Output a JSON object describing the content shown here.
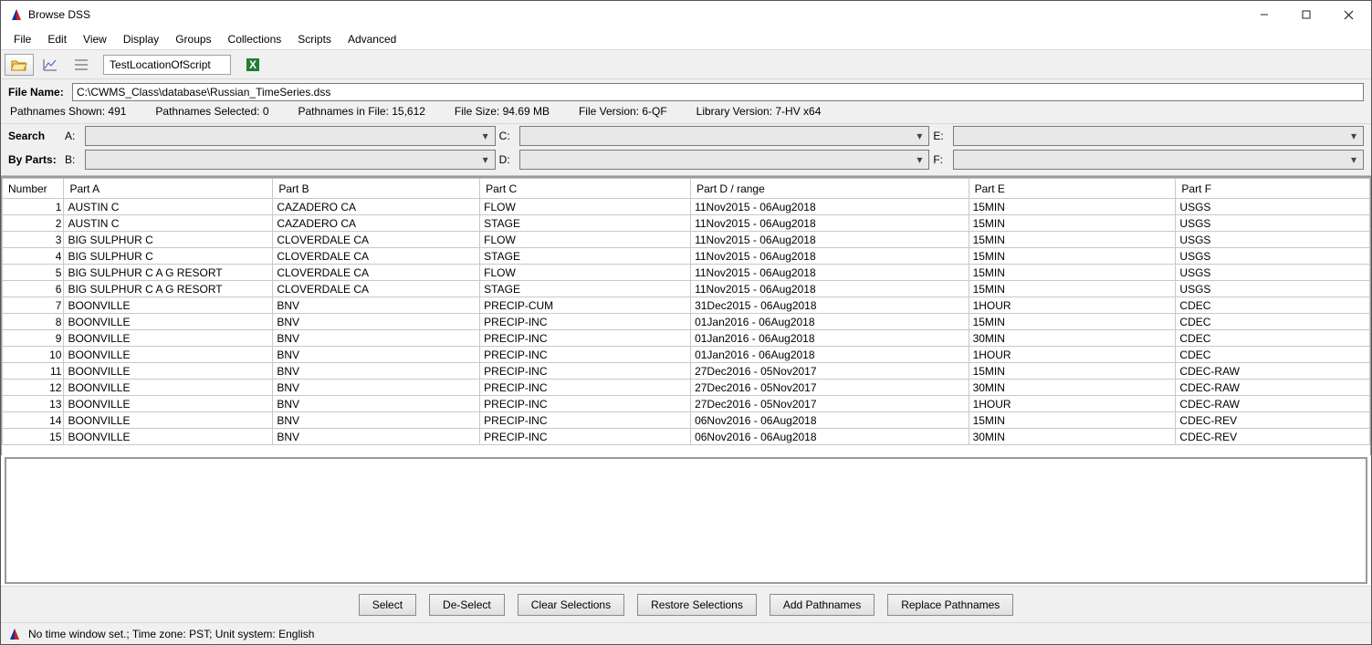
{
  "window": {
    "title": "Browse DSS"
  },
  "menus": [
    "File",
    "Edit",
    "View",
    "Display",
    "Groups",
    "Collections",
    "Scripts",
    "Advanced"
  ],
  "toolbar": {
    "script_name": "TestLocationOfScript"
  },
  "file": {
    "label": "File Name:",
    "path": "C:\\CWMS_Class\\database\\Russian_TimeSeries.dss"
  },
  "stats": {
    "shown": "Pathnames Shown:  491",
    "selected": "Pathnames Selected: 0",
    "infile": "Pathnames in File:  15,612",
    "filesize": "File Size:  94.69  MB",
    "fileversion": "File Version: 6-QF",
    "libversion": "Library Version: 7-HV    x64"
  },
  "search": {
    "label1": "Search",
    "label2": "By Parts:",
    "parts": {
      "A": "A:",
      "B": "B:",
      "C": "C:",
      "D": "D:",
      "E": "E:",
      "F": "F:"
    }
  },
  "columns": [
    "Number",
    "Part A",
    "Part B",
    "Part C",
    "Part D / range",
    "Part E",
    "Part F"
  ],
  "rows": [
    {
      "n": 1,
      "a": "AUSTIN C",
      "b": "CAZADERO CA",
      "c": "FLOW",
      "d": "11Nov2015 - 06Aug2018",
      "e": "15MIN",
      "f": "USGS"
    },
    {
      "n": 2,
      "a": "AUSTIN C",
      "b": "CAZADERO CA",
      "c": "STAGE",
      "d": "11Nov2015 - 06Aug2018",
      "e": "15MIN",
      "f": "USGS"
    },
    {
      "n": 3,
      "a": "BIG SULPHUR C",
      "b": "CLOVERDALE CA",
      "c": "FLOW",
      "d": "11Nov2015 - 06Aug2018",
      "e": "15MIN",
      "f": "USGS"
    },
    {
      "n": 4,
      "a": "BIG SULPHUR C",
      "b": "CLOVERDALE CA",
      "c": "STAGE",
      "d": "11Nov2015 - 06Aug2018",
      "e": "15MIN",
      "f": "USGS"
    },
    {
      "n": 5,
      "a": "BIG SULPHUR C A G RESORT",
      "b": "CLOVERDALE CA",
      "c": "FLOW",
      "d": "11Nov2015 - 06Aug2018",
      "e": "15MIN",
      "f": "USGS"
    },
    {
      "n": 6,
      "a": "BIG SULPHUR C A G RESORT",
      "b": "CLOVERDALE CA",
      "c": "STAGE",
      "d": "11Nov2015 - 06Aug2018",
      "e": "15MIN",
      "f": "USGS"
    },
    {
      "n": 7,
      "a": "BOONVILLE",
      "b": "BNV",
      "c": "PRECIP-CUM",
      "d": "31Dec2015 - 06Aug2018",
      "e": "1HOUR",
      "f": "CDEC"
    },
    {
      "n": 8,
      "a": "BOONVILLE",
      "b": "BNV",
      "c": "PRECIP-INC",
      "d": "01Jan2016 - 06Aug2018",
      "e": "15MIN",
      "f": "CDEC"
    },
    {
      "n": 9,
      "a": "BOONVILLE",
      "b": "BNV",
      "c": "PRECIP-INC",
      "d": "01Jan2016 - 06Aug2018",
      "e": "30MIN",
      "f": "CDEC"
    },
    {
      "n": 10,
      "a": "BOONVILLE",
      "b": "BNV",
      "c": "PRECIP-INC",
      "d": "01Jan2016 - 06Aug2018",
      "e": "1HOUR",
      "f": "CDEC"
    },
    {
      "n": 11,
      "a": "BOONVILLE",
      "b": "BNV",
      "c": "PRECIP-INC",
      "d": "27Dec2016 - 05Nov2017",
      "e": "15MIN",
      "f": "CDEC-RAW"
    },
    {
      "n": 12,
      "a": "BOONVILLE",
      "b": "BNV",
      "c": "PRECIP-INC",
      "d": "27Dec2016 - 05Nov2017",
      "e": "30MIN",
      "f": "CDEC-RAW"
    },
    {
      "n": 13,
      "a": "BOONVILLE",
      "b": "BNV",
      "c": "PRECIP-INC",
      "d": "27Dec2016 - 05Nov2017",
      "e": "1HOUR",
      "f": "CDEC-RAW"
    },
    {
      "n": 14,
      "a": "BOONVILLE",
      "b": "BNV",
      "c": "PRECIP-INC",
      "d": "06Nov2016 - 06Aug2018",
      "e": "15MIN",
      "f": "CDEC-REV"
    },
    {
      "n": 15,
      "a": "BOONVILLE",
      "b": "BNV",
      "c": "PRECIP-INC",
      "d": "06Nov2016 - 06Aug2018",
      "e": "30MIN",
      "f": "CDEC-REV"
    }
  ],
  "buttons": [
    "Select",
    "De-Select",
    "Clear Selections",
    "Restore Selections",
    "Add Pathnames",
    "Replace Pathnames"
  ],
  "status": "No time window set.;  Time zone: PST;  Unit system: English"
}
